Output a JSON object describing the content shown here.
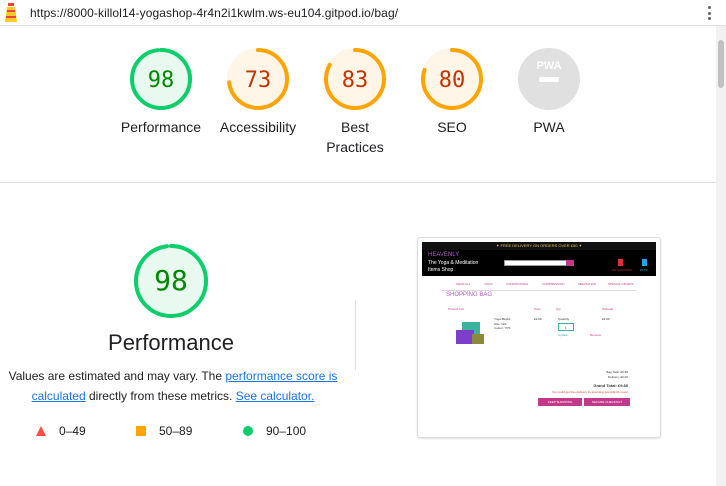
{
  "browser": {
    "url": "https://8000-killol14-yogashop-4r4n2i1kwlm.ws-eu104.gitpod.io/bag/"
  },
  "colors": {
    "pass": "#0cce6b",
    "average": "#ffa400",
    "fail": "#ff4e42",
    "pwa_gray": "#cccccc",
    "link": "#1a73e8"
  },
  "scores": [
    {
      "label": "Performance",
      "value": "98",
      "score": 98,
      "rating": "pass"
    },
    {
      "label": "Accessibility",
      "value": "73",
      "score": 73,
      "rating": "average"
    },
    {
      "label": "Best Practices",
      "value": "83",
      "score": 83,
      "rating": "average"
    },
    {
      "label": "SEO",
      "value": "80",
      "score": 80,
      "rating": "average"
    },
    {
      "label": "PWA",
      "value": "PWA",
      "rating": "na"
    }
  ],
  "performance_detail": {
    "score": "98",
    "score_value": 98,
    "title": "Performance",
    "desc_1": "Values are estimated and may vary. The ",
    "link_1": "performance score is calculated",
    "desc_2": " directly from these metrics. ",
    "link_2": "See calculator."
  },
  "legend": [
    {
      "icon": "triangle-icon",
      "range": "0–49"
    },
    {
      "icon": "square-icon",
      "range": "50–89"
    },
    {
      "icon": "circle-icon",
      "range": "90–100"
    }
  ],
  "screenshot": {
    "banner": "✦ FREE DELIVERY ON ORDERS OVER £50 ✦",
    "brand_1": "HEAVENLY",
    "brand_2": "The Yoga & Meditation",
    "brand_3": "Items Shop",
    "account": "MY ACCOUNT",
    "bag": "£9.89",
    "nav": [
      "SHOP ALL",
      "YOGA",
      "CONDITIONING",
      "COMPRESSION",
      "MEDITATION",
      "SPECIAL OFFERS"
    ],
    "title": "SHOPPING BAG",
    "headers": [
      "Product Info",
      "Price",
      "Qty",
      "Subtotal"
    ],
    "product_name": "Yoga Blocks",
    "product_size": "Size: N/A",
    "product_sku": "Colour: YPS",
    "price": "£9.99",
    "quantity_label": "Quantity",
    "qty_value": "1",
    "update": "Update",
    "remove": "Remove",
    "subtotal": "£9.99",
    "bag_total": "Bag Total: £9.99",
    "delivery": "Delivery: £0.00",
    "grand_total": "Grand Total: £9.89",
    "note": "You could get free delivery by spending just £40.01 more!",
    "keep_shopping": "KEEP SHOPPING",
    "checkout": "SECURE CHECKOUT"
  }
}
